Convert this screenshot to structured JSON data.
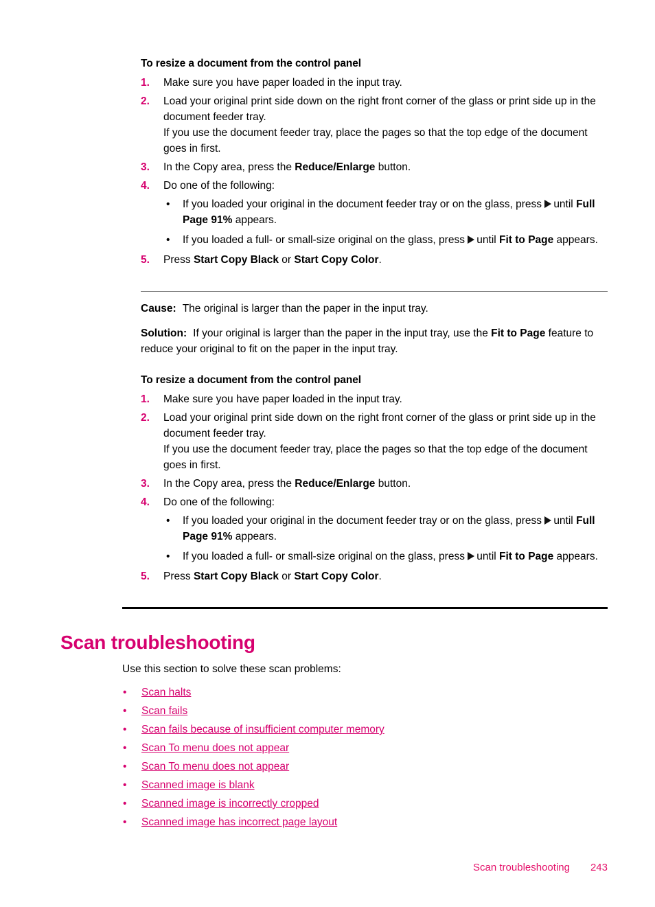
{
  "procedure": {
    "title": "To resize a document from the control panel",
    "steps": [
      {
        "num": "1.",
        "text": "Make sure you have paper loaded in the input tray."
      },
      {
        "num": "2.",
        "text": "Load your original print side down on the right front corner of the glass or print side up in the document feeder tray.",
        "extra": "If you use the document feeder tray, place the pages so that the top edge of the document goes in first."
      },
      {
        "num": "3.",
        "pre": "In the Copy area, press the ",
        "bold": "Reduce/Enlarge",
        "post": " button."
      },
      {
        "num": "4.",
        "text": "Do one of the following:",
        "bullets": [
          {
            "dot": "•",
            "pre": "If you loaded your original in the document feeder tray or on the glass, press ",
            "icon": "right-arrow-glyph",
            "mid": "until ",
            "bold": "Full Page 91%",
            "post": " appears."
          },
          {
            "dot": "•",
            "pre": "If you loaded a full- or small-size original on the glass, press ",
            "icon": "right-arrow-glyph",
            "mid": "until ",
            "bold": "Fit to Page",
            "post": " appears."
          }
        ]
      },
      {
        "num": "5.",
        "pre": "Press ",
        "bold": "Start Copy Black",
        "mid": " or ",
        "bold2": "Start Copy Color",
        "post": "."
      }
    ]
  },
  "cause_solution": {
    "cause_label": "Cause:",
    "cause_text": "The original is larger than the paper in the input tray.",
    "solution_label": "Solution:",
    "solution_pre": "If your original is larger than the paper in the input tray, use the ",
    "solution_bold": "Fit to Page",
    "solution_post": " feature to reduce your original to fit on the paper in the input tray."
  },
  "section": {
    "heading": "Scan troubleshooting",
    "intro": "Use this section to solve these scan problems:",
    "links": [
      {
        "dot": "•",
        "label": "Scan halts"
      },
      {
        "dot": "•",
        "label": "Scan fails"
      },
      {
        "dot": "•",
        "label": "Scan fails because of insufficient computer memory"
      },
      {
        "dot": "•",
        "label": "Scan To menu does not appear"
      },
      {
        "dot": "•",
        "label": "Scan To menu does not appear"
      },
      {
        "dot": "•",
        "label": "Scanned image is blank"
      },
      {
        "dot": "•",
        "label": "Scanned image is incorrectly cropped"
      },
      {
        "dot": "•",
        "label": "Scanned image has incorrect page layout"
      }
    ]
  },
  "footer": {
    "title": "Scan troubleshooting",
    "page": "243"
  },
  "colors": {
    "accent_pink": "#D6006E",
    "footer_pink": "#E5126B",
    "rule_gray": "#808080",
    "rule_black": "#000000",
    "text_black": "#000000"
  }
}
